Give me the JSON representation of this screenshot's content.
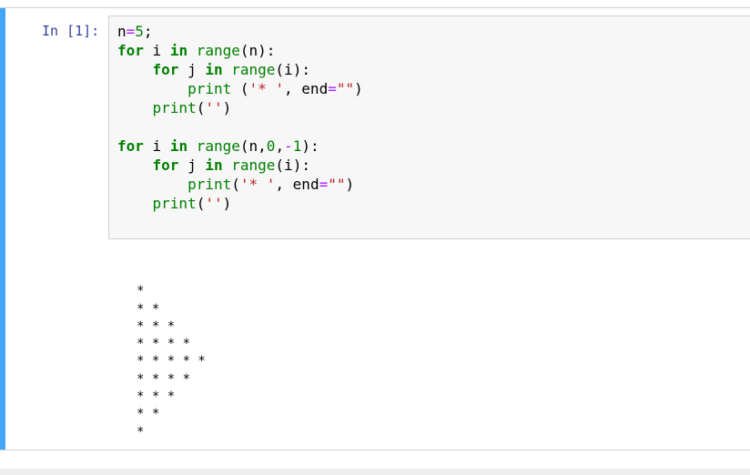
{
  "cell": {
    "prompt": "In [1]:",
    "selected_color": "#42a5f5",
    "code_lines": [
      [
        {
          "t": "n",
          "c": ""
        },
        {
          "t": "=",
          "c": "op"
        },
        {
          "t": "5",
          "c": "num"
        },
        {
          "t": ";",
          "c": ""
        }
      ],
      [
        {
          "t": "for",
          "c": "kw"
        },
        {
          "t": " i ",
          "c": ""
        },
        {
          "t": "in",
          "c": "kw"
        },
        {
          "t": " ",
          "c": ""
        },
        {
          "t": "range",
          "c": "builtin"
        },
        {
          "t": "(n):",
          "c": ""
        }
      ],
      [
        {
          "t": "    ",
          "c": ""
        },
        {
          "t": "for",
          "c": "kw"
        },
        {
          "t": " j ",
          "c": ""
        },
        {
          "t": "in",
          "c": "kw"
        },
        {
          "t": " ",
          "c": ""
        },
        {
          "t": "range",
          "c": "builtin"
        },
        {
          "t": "(i):",
          "c": ""
        }
      ],
      [
        {
          "t": "        ",
          "c": ""
        },
        {
          "t": "print",
          "c": "builtin"
        },
        {
          "t": " (",
          "c": ""
        },
        {
          "t": "'* '",
          "c": "str"
        },
        {
          "t": ", end",
          "c": ""
        },
        {
          "t": "=",
          "c": "op"
        },
        {
          "t": "\"\"",
          "c": "str"
        },
        {
          "t": ")",
          "c": ""
        }
      ],
      [
        {
          "t": "    ",
          "c": ""
        },
        {
          "t": "print",
          "c": "builtin"
        },
        {
          "t": "(",
          "c": ""
        },
        {
          "t": "''",
          "c": "str"
        },
        {
          "t": ")",
          "c": ""
        }
      ],
      [
        {
          "t": "",
          "c": ""
        }
      ],
      [
        {
          "t": "for",
          "c": "kw"
        },
        {
          "t": " i ",
          "c": ""
        },
        {
          "t": "in",
          "c": "kw"
        },
        {
          "t": " ",
          "c": ""
        },
        {
          "t": "range",
          "c": "builtin"
        },
        {
          "t": "(n,",
          "c": ""
        },
        {
          "t": "0",
          "c": "num"
        },
        {
          "t": ",",
          "c": ""
        },
        {
          "t": "-",
          "c": "op"
        },
        {
          "t": "1",
          "c": "num"
        },
        {
          "t": "):",
          "c": ""
        }
      ],
      [
        {
          "t": "    ",
          "c": ""
        },
        {
          "t": "for",
          "c": "kw"
        },
        {
          "t": " j ",
          "c": ""
        },
        {
          "t": "in",
          "c": "kw"
        },
        {
          "t": " ",
          "c": ""
        },
        {
          "t": "range",
          "c": "builtin"
        },
        {
          "t": "(i):",
          "c": ""
        }
      ],
      [
        {
          "t": "        ",
          "c": ""
        },
        {
          "t": "print",
          "c": "builtin"
        },
        {
          "t": "(",
          "c": ""
        },
        {
          "t": "'* '",
          "c": "str"
        },
        {
          "t": ", end",
          "c": ""
        },
        {
          "t": "=",
          "c": "op"
        },
        {
          "t": "\"\"",
          "c": "str"
        },
        {
          "t": ")",
          "c": ""
        }
      ],
      [
        {
          "t": "    ",
          "c": ""
        },
        {
          "t": "print",
          "c": "builtin"
        },
        {
          "t": "(",
          "c": ""
        },
        {
          "t": "''",
          "c": "str"
        },
        {
          "t": ")",
          "c": ""
        }
      ]
    ],
    "output_lines": [
      "",
      "* ",
      "* * ",
      "* * * ",
      "* * * * ",
      "* * * * * ",
      "* * * * ",
      "* * * ",
      "* * ",
      "* "
    ]
  }
}
